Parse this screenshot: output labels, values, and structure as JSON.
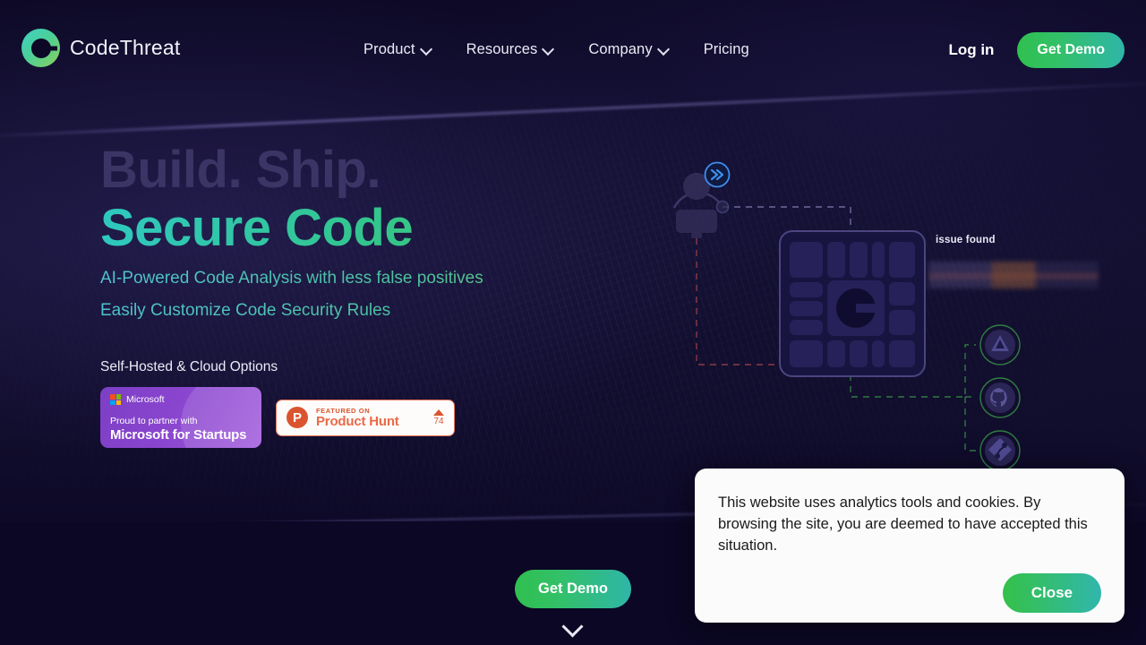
{
  "brand": {
    "name": "CodeThreat",
    "logo_icon": "codethreat-logo-icon"
  },
  "nav": {
    "items": [
      {
        "label": "Product",
        "has_dropdown": true
      },
      {
        "label": "Resources",
        "has_dropdown": true
      },
      {
        "label": "Company",
        "has_dropdown": true
      },
      {
        "label": "Pricing",
        "has_dropdown": false
      }
    ],
    "login_label": "Log in",
    "demo_label": "Get Demo"
  },
  "hero": {
    "heading_muted": "Build. Ship.",
    "heading_accent": "Secure Code",
    "subtitle_line1": "AI-Powered Code Analysis with less false positives",
    "subtitle_line2": "Easily Customize Code Security Rules",
    "note": "Self-Hosted & Cloud Options"
  },
  "badges": {
    "microsoft": {
      "brand": "Microsoft",
      "line1": "Proud to partner with",
      "line2": "Microsoft for Startups"
    },
    "product_hunt": {
      "logo_letter": "P",
      "small_label": "FEATURED ON",
      "name": "Product Hunt",
      "upvotes": "74"
    }
  },
  "illustration": {
    "issue_label": "issue found",
    "developer_icon": "developer-at-desk-icon",
    "badge_icon": "fast-forward-badge-icon",
    "core_icon": "codethreat-core-node-icon",
    "integrations": [
      {
        "name": "azure-devops-icon"
      },
      {
        "name": "github-icon"
      },
      {
        "name": "gitlab-icon"
      }
    ]
  },
  "cta": {
    "demo_label": "Get Demo",
    "scroll_icon": "chevron-down-icon"
  },
  "cookie": {
    "message": "This website uses analytics tools and cookies. By browsing the site, you are deemed to have accepted this situation.",
    "close_label": "Close"
  },
  "colors": {
    "background": "#0c0826",
    "accent_green": "#2fc04f",
    "accent_teal": "#2fb6a8",
    "heading_muted": "#3b3566",
    "product_hunt": "#da552f",
    "microsoft_purple": "#8a45cf"
  }
}
